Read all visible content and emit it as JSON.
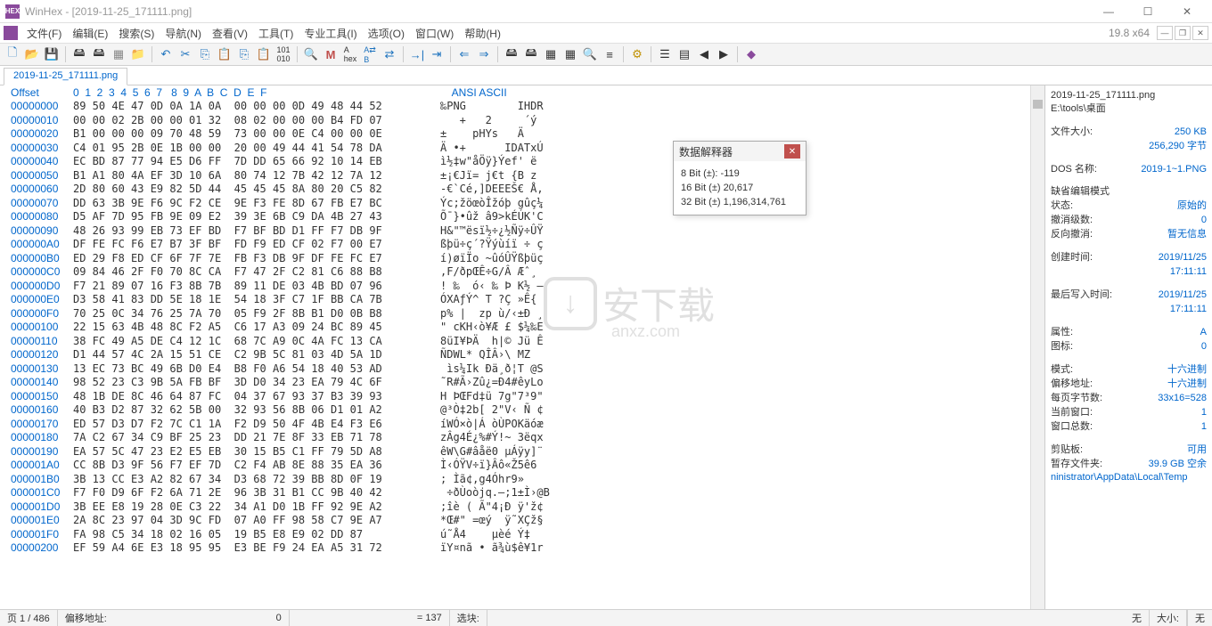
{
  "titlebar": {
    "title": "WinHex - [2019-11-25_171111.png]"
  },
  "version": "19.8 x64",
  "menus": [
    "文件(F)",
    "编辑(E)",
    "搜索(S)",
    "导航(N)",
    "查看(V)",
    "工具(T)",
    "专业工具(I)",
    "选项(O)",
    "窗口(W)",
    "帮助(H)"
  ],
  "tab": "2019-11-25_171111.png",
  "hex_header": {
    "offset": "Offset",
    "cols": "0  1  2  3  4  5  6  7   8  9  A  B  C  D  E  F",
    "ascii": "    ANSI ASCII"
  },
  "rows": [
    {
      "o": "00000000",
      "h": "89 50 4E 47 0D 0A 1A 0A  00 00 00 0D 49 48 44 52",
      "a": "‰PNG        IHDR"
    },
    {
      "o": "00000010",
      "h": "00 00 02 2B 00 00 01 32  08 02 00 00 00 B4 FD 07",
      "a": "   +   2     ´ý"
    },
    {
      "o": "00000020",
      "h": "B1 00 00 00 09 70 48 59  73 00 00 0E C4 00 00 0E",
      "a": "±    pHYs   Ä"
    },
    {
      "o": "00000030",
      "h": "C4 01 95 2B 0E 1B 00 00  20 00 49 44 41 54 78 DA",
      "a": "Ä •+      IDATxÚ"
    },
    {
      "o": "00000040",
      "h": "EC BD 87 77 94 E5 D6 FF  7D DD 65 66 92 10 14 EB",
      "a": "ì½‡w\"åÖÿ}Ýef' ë"
    },
    {
      "o": "00000050",
      "h": "B1 A1 80 4A EF 3D 10 6A  80 74 12 7B 42 12 7A 12",
      "a": "±¡€Jï= j€t {B z"
    },
    {
      "o": "00000060",
      "h": "2D 80 60 43 E9 82 5D 44  45 45 45 8A 80 20 C5 82",
      "a": "-€`Cé‚]DEEEŠ€ Å‚"
    },
    {
      "o": "00000070",
      "h": "DD 63 3B 9E F6 9C F2 CE  9E F3 FE 8D 67 FB E7 BC",
      "a": "Ýc;žöœòÎžóþ gûç¼"
    },
    {
      "o": "00000080",
      "h": "D5 AF 7D 95 FB 9E 09 E2  39 3E 6B C9 DA 4B 27 43",
      "a": "Õ¯}•ûž â9>kÉÚK'C"
    },
    {
      "o": "00000090",
      "h": "48 26 93 99 EB 73 EF BD  F7 BF BD D1 FF F7 DB 9F",
      "a": "H&\"™ësï½÷¿½Ñÿ÷ÛŸ"
    },
    {
      "o": "000000A0",
      "h": "DF FE FC F6 E7 B7 3F BF  FD F9 ED CF 02 F7 00 E7",
      "a": "ßþü÷ç´?Ÿýùíï ÷ ç"
    },
    {
      "o": "000000B0",
      "h": "ED 29 F8 ED CF 6F 7F 7E  FB F3 DB 9F DF FE FC E7",
      "a": "í)øïÏo ~ûóÛŸßþüç"
    },
    {
      "o": "000000C0",
      "h": "09 84 46 2F F0 70 8C CA  F7 47 2F C2 81 C6 88 B8",
      "a": ",F/ðpŒÊ÷G/Â Æˆ¸"
    },
    {
      "o": "000000D0",
      "h": "F7 21 89 07 16 F3 8B 7B  89 11 DE 03 4B BD 07 96",
      "a": "! ‰  ó‹ ‰ Þ K½ –"
    },
    {
      "o": "000000E0",
      "h": "D3 58 41 83 DD 5E 18 1E  54 18 3F C7 1F BB CA 7B",
      "a": "ÓXAƒÝ^ T ?Ç »Ê{"
    },
    {
      "o": "000000F0",
      "h": "70 25 0C 34 76 25 7A 70  05 F9 2F 8B B1 D0 0B B8",
      "a": "p% |  zp ù/‹±Ð ¸"
    },
    {
      "o": "00000100",
      "h": "22 15 63 4B 48 8C F2 A5  C6 17 A3 09 24 BC 89 45",
      "a": "\" cKH‹ò¥Æ £ $¼‰E"
    },
    {
      "o": "00000110",
      "h": "38 FC 49 A5 DE C4 12 1C  68 7C A9 0C 4A FC 13 CA",
      "a": "8üI¥ÞÄ  h|© Jü Ê"
    },
    {
      "o": "00000120",
      "h": "D1 44 57 4C 2A 15 51 CE  C2 9B 5C 81 03 4D 5A 1D",
      "a": "ÑDWL* QÎÂ›\\ MZ"
    },
    {
      "o": "00000130",
      "h": "13 EC 73 BC 49 6B D0 E4  B8 F0 A6 54 18 40 53 AD",
      "a": " ìs¼Ik Ðä¸ð¦T @S­"
    },
    {
      "o": "00000140",
      "h": "98 52 23 C3 9B 5A FB BF  3D D0 34 23 EA 79 4C 6F",
      "a": "˜R#Ã›Zû¿=Ð4#êyLo"
    },
    {
      "o": "00000150",
      "h": "48 1B DE 8C 46 64 87 FC  04 37 67 93 37 B3 39 93",
      "a": "H ÞŒFd‡ü 7g\"7³9\""
    },
    {
      "o": "00000160",
      "h": "40 B3 D2 87 32 62 5B 00  32 93 56 8B 06 D1 01 A2",
      "a": "@³Ò‡2b[ 2\"V‹ Ñ ¢"
    },
    {
      "o": "00000170",
      "h": "ED 57 D3 D7 F2 7C C1 1A  F2 D9 50 4F 4B E4 F3 E6",
      "a": "íWÓ×ò|Á òÙPOKäóæ"
    },
    {
      "o": "00000180",
      "h": "7A C2 67 34 C9 BF 25 23  DD 21 7E 8F 33 EB 71 78",
      "a": "zÂg4É¿%#Ý!~ 3ëqx"
    },
    {
      "o": "00000190",
      "h": "EA 57 5C 47 23 E2 E5 EB  30 15 B5 C1 FF 79 5D A8",
      "a": "êW\\G#âåë0 µÁÿy]¨"
    },
    {
      "o": "000001A0",
      "h": "CC 8B D3 9F 56 F7 EF 7D  C2 F4 AB 8E 88 35 EA 36",
      "a": "Ì‹ÓŸV÷ï}Âô«Ž5ê6"
    },
    {
      "o": "000001B0",
      "h": "3B 13 CC E3 A2 82 67 34  D3 68 72 39 BB 8D 0F 19",
      "a": "; Ìã¢‚g4Óhr9» "
    },
    {
      "o": "000001C0",
      "h": "F7 F0 D9 6F F2 6A 71 2E  96 3B 31 B1 CC 9B 40 42",
      "a": " ÷ðÙoòjq.–;1±Ì›@B"
    },
    {
      "o": "000001D0",
      "h": "3B EE E8 19 28 0E C3 22  34 A1 D0 1B FF 92 9E A2",
      "a": ";îè ( Ã\"4¡Ð ÿ'ž¢"
    },
    {
      "o": "000001E0",
      "h": "2A 8C 23 97 04 3D 9C FD  07 A0 FF 98 58 C7 9E A7",
      "a": "*Œ#\" =œý  ÿ˜XÇž§"
    },
    {
      "o": "000001F0",
      "h": "FA 98 C5 34 18 02 16 05  19 B5 E8 E9 02 DD 87",
      "a": "ú˜Å4    µèé Ý‡"
    },
    {
      "o": "00000200",
      "h": "EF 59 A4 6E E3 18 95 95  E3 BE F9 24 EA A5 31 72",
      "a": "ïY¤nã • ã¾ù$ê¥1r"
    }
  ],
  "interpreter": {
    "title": "数据解释器",
    "bit8": "8 Bit (±): -119",
    "bit16": "16 Bit (±) 20,617",
    "bit32": "32 Bit (±) 1,196,314,761"
  },
  "side": {
    "filename": "2019-11-25_171111.png",
    "path": "E:\\tools\\桌面",
    "filesize_lbl": "文件大小:",
    "filesize": "250 KB",
    "filesize2": "256,290 字节",
    "dosname_lbl": "DOS 名称:",
    "dosname": "2019-1~1.PNG",
    "editmode": "缺省编辑模式",
    "state_lbl": "状态:",
    "state": "原始的",
    "undo_lbl": "撤消级数:",
    "undo": "0",
    "revundo_lbl": "反向撤消:",
    "revundo": "暂无信息",
    "created_lbl": "创建时间:",
    "created_d": "2019/11/25",
    "created_t": "17:11:11",
    "written_lbl": "最后写入时间:",
    "written_d": "2019/11/25",
    "written_t": "17:11:11",
    "attr_lbl": "属性:",
    "attr": "A",
    "icon_lbl": "图标:",
    "icon": "0",
    "mode_lbl": "模式:",
    "mode": "十六进制",
    "offaddr_lbl": "偏移地址:",
    "offaddr": "十六进制",
    "bpp_lbl": "每页字节数:",
    "bpp": "33x16=528",
    "curwin_lbl": "当前窗口:",
    "curwin": "1",
    "wintot_lbl": "窗口总数:",
    "wintot": "1",
    "clip_lbl": "剪贴板:",
    "clip": "可用",
    "tmp_lbl": "暂存文件夹:",
    "tmp": "39.9 GB 空余",
    "tmppath": "ninistrator\\AppData\\Local\\Temp"
  },
  "status": {
    "page": "页 1 / 486",
    "offlbl": "偏移地址:",
    "off": "0",
    "eq": "= 137",
    "sel": "选块:",
    "selv": "无",
    "size": "大小:",
    "sizev": "无"
  },
  "watermark": {
    "text": "安下载",
    "sub": "anxz.com"
  }
}
